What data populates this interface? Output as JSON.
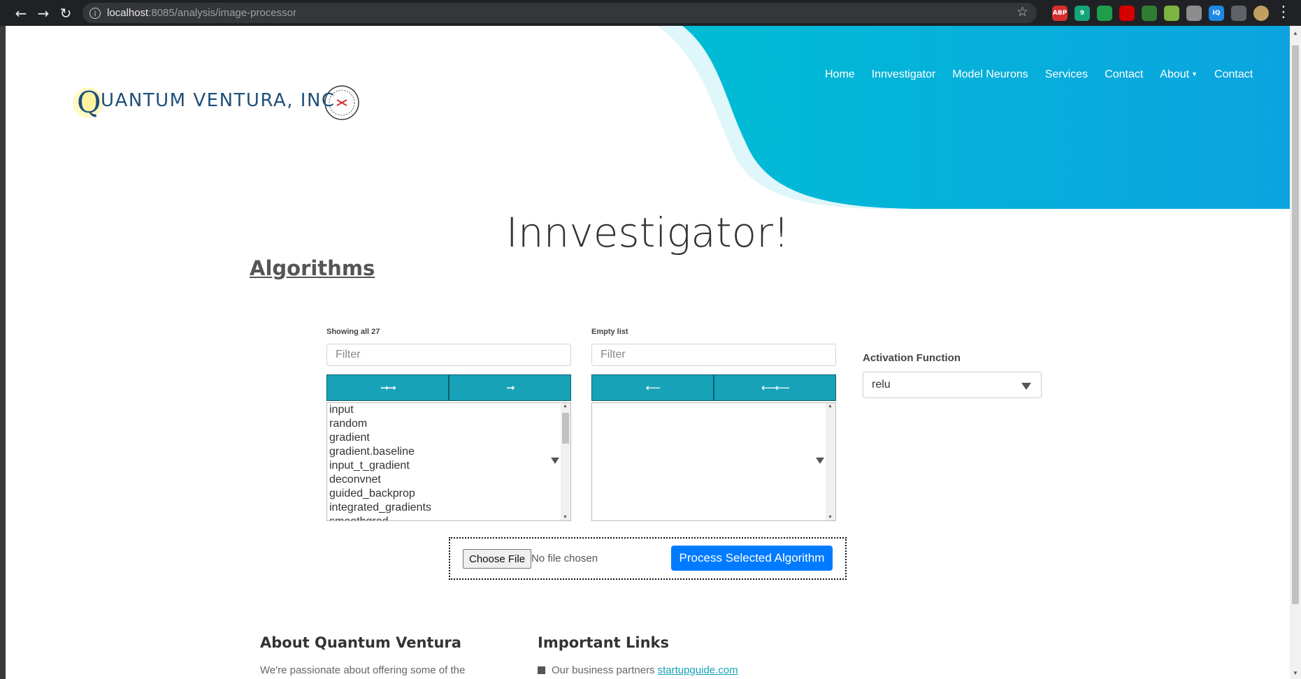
{
  "browser": {
    "url_host": "localhost",
    "url_rest": ":8085/analysis/image-processor",
    "extensions": [
      {
        "name": "adblock-plus-icon",
        "label": "ABP",
        "color": "#d32f2f"
      },
      {
        "name": "grammarly-icon",
        "label": "9",
        "color": "#15a37a"
      },
      {
        "name": "green-leaf-icon",
        "label": "",
        "color": "#1e9e4a"
      },
      {
        "name": "red-shield-icon",
        "label": "",
        "color": "#d50000"
      },
      {
        "name": "green-cube-icon",
        "label": "",
        "color": "#2e7d32"
      },
      {
        "name": "hex-icon",
        "label": "",
        "color": "#7cb342"
      },
      {
        "name": "grey-box-icon",
        "label": "",
        "color": "#8d8d8d"
      },
      {
        "name": "iq-icon",
        "label": "IQ",
        "color": "#1e88e5"
      },
      {
        "name": "puzzle-icon",
        "label": "",
        "color": "#5f6368"
      },
      {
        "name": "profile-avatar-icon",
        "label": "",
        "color": "#c0a060"
      }
    ]
  },
  "logo": {
    "text": "UANTUM VENTURA, INC",
    "q_letter": "Q"
  },
  "nav": {
    "items": [
      "Home",
      "Innvestigator",
      "Model Neurons",
      "Services",
      "Contact",
      "About",
      "Contact"
    ]
  },
  "hero": {
    "title": "Innvestigator!",
    "section_heading": "Algorithms"
  },
  "dual_list": {
    "left_count": "Showing all 27",
    "right_count": "Empty list",
    "filter_placeholder": "Filter",
    "move_all_label": "➞➞",
    "move_one_label": "➞",
    "remove_one_label": "⟵",
    "remove_all_label": "⟵⟵",
    "available": [
      "input",
      "random",
      "gradient",
      "gradient.baseline",
      "input_t_gradient",
      "deconvnet",
      "guided_backprop",
      "integrated_gradients",
      "smoothgrad"
    ]
  },
  "activation": {
    "label": "Activation Function",
    "value": "relu"
  },
  "upload": {
    "choose_label": "Choose File",
    "status": "No file chosen",
    "process_label": "Process Selected Algorithm"
  },
  "footer": {
    "about_heading": "About Quantum Ventura",
    "about_text": "We're passionate about offering some of the",
    "links_heading": "Important Links",
    "partners_text": "Our business partners",
    "partners_link": "startupguide.com"
  },
  "colors": {
    "header_gradient_start": "#00bcd4",
    "header_gradient_end": "#0ba4e0",
    "accent_teal": "#17a2b8",
    "primary_blue": "#007bff"
  }
}
